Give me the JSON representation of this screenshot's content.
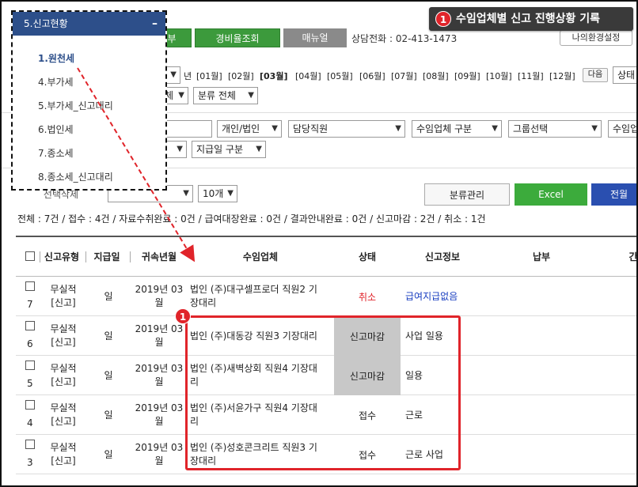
{
  "callout": {
    "badge": "1",
    "text": "수임업체별 신고 진행상황 기록"
  },
  "topbar": {
    "button_partial": "부",
    "expense_btn": "경비율조회",
    "manual_btn": "매뉴얼",
    "phone": "상담전화 : 02-413-1473",
    "env_btn": "나의환경설정"
  },
  "popup": {
    "header": "5.신고현황",
    "collapse": "–",
    "items": [
      "1.원천세",
      "4.부가세",
      "5.부가세_신고대리",
      "6.법인세",
      "7.종소세",
      "8.종소세_신고대리"
    ],
    "active_index": 0
  },
  "period": {
    "year_suffix": "년",
    "months": [
      "[01월]",
      "[02월]",
      "[03월]",
      "[04월]",
      "[05월]",
      "[06월]",
      "[07월]",
      "[08월]",
      "[09월]",
      "[10월]",
      "[11월]",
      "[12월]"
    ],
    "active_month": 2,
    "next_btn": "다음",
    "status_partial": "상태"
  },
  "filters": {
    "row1": {
      "partial": "체",
      "category": "분류 전체"
    },
    "row2": {
      "type": "개인/법인",
      "staff": "담당직원",
      "client_type": "수임업체 구분",
      "group": "그룹선택",
      "client_partial": "수임업"
    },
    "row3": {
      "pay_date": "지급일 구분"
    }
  },
  "list_controls": {
    "select_partial": "선택삭제",
    "page_size": "10개",
    "category_btn": "분류관리",
    "excel_btn": "Excel",
    "all_partial": "전월"
  },
  "summary": "전체 : 7건 / 접수 : 4건 / 자료수취완료 : 0건 / 급여대장완료 : 0건 / 결과안내완료 : 0건 / 신고마감 : 2건 / 취소 : 1건",
  "table": {
    "headers": [
      "신고유형",
      "지급일",
      "귀속년월",
      "수임업체",
      "상태",
      "신고정보",
      "납부",
      "간"
    ],
    "rows": [
      {
        "no": "7",
        "type1": "무실적",
        "type2": "[신고]",
        "pay": "일",
        "period1": "2019년 03",
        "period2": "월",
        "client1": "법인 (주)대구셀프로더 직원2 기",
        "client2": "장대리",
        "status": "취소",
        "status_style": "red",
        "info": "급여지급없음",
        "info_style": "blue"
      },
      {
        "no": "6",
        "type1": "무실적",
        "type2": "[신고]",
        "pay": "일",
        "period1": "2019년 03",
        "period2": "월",
        "client1": "법인 (주)대동강 직원3 기장대리",
        "client2": "",
        "status": "신고마감",
        "status_style": "gray",
        "info": "사업 일용",
        "info_style": ""
      },
      {
        "no": "5",
        "type1": "무실적",
        "type2": "[신고]",
        "pay": "일",
        "period1": "2019년 03",
        "period2": "월",
        "client1": "법인 (주)새벽상회 직원4 기장대",
        "client2": "리",
        "status": "신고마감",
        "status_style": "gray",
        "info": "일용",
        "info_style": ""
      },
      {
        "no": "4",
        "type1": "무실적",
        "type2": "[신고]",
        "pay": "일",
        "period1": "2019년 03",
        "period2": "월",
        "client1": "법인 (주)서윤가구 직원4 기장대",
        "client2": "리",
        "status": "접수",
        "status_style": "",
        "info": "근로",
        "info_style": ""
      },
      {
        "no": "3",
        "type1": "무실적",
        "type2": "[신고]",
        "pay": "일",
        "period1": "2019년 03",
        "period2": "월",
        "client1": "법인 (주)성호콘크리트 직원3 기",
        "client2": "장대리",
        "status": "접수",
        "status_style": "",
        "info": "근로 사업",
        "info_style": ""
      }
    ]
  },
  "annotation_badge": "1",
  "colors": {
    "accent_red": "#e0242a",
    "nav_blue": "#2d4f8a",
    "green": "#3c9a3c",
    "excel_green": "#3cab3c",
    "blue_btn": "#2a4fb0"
  }
}
